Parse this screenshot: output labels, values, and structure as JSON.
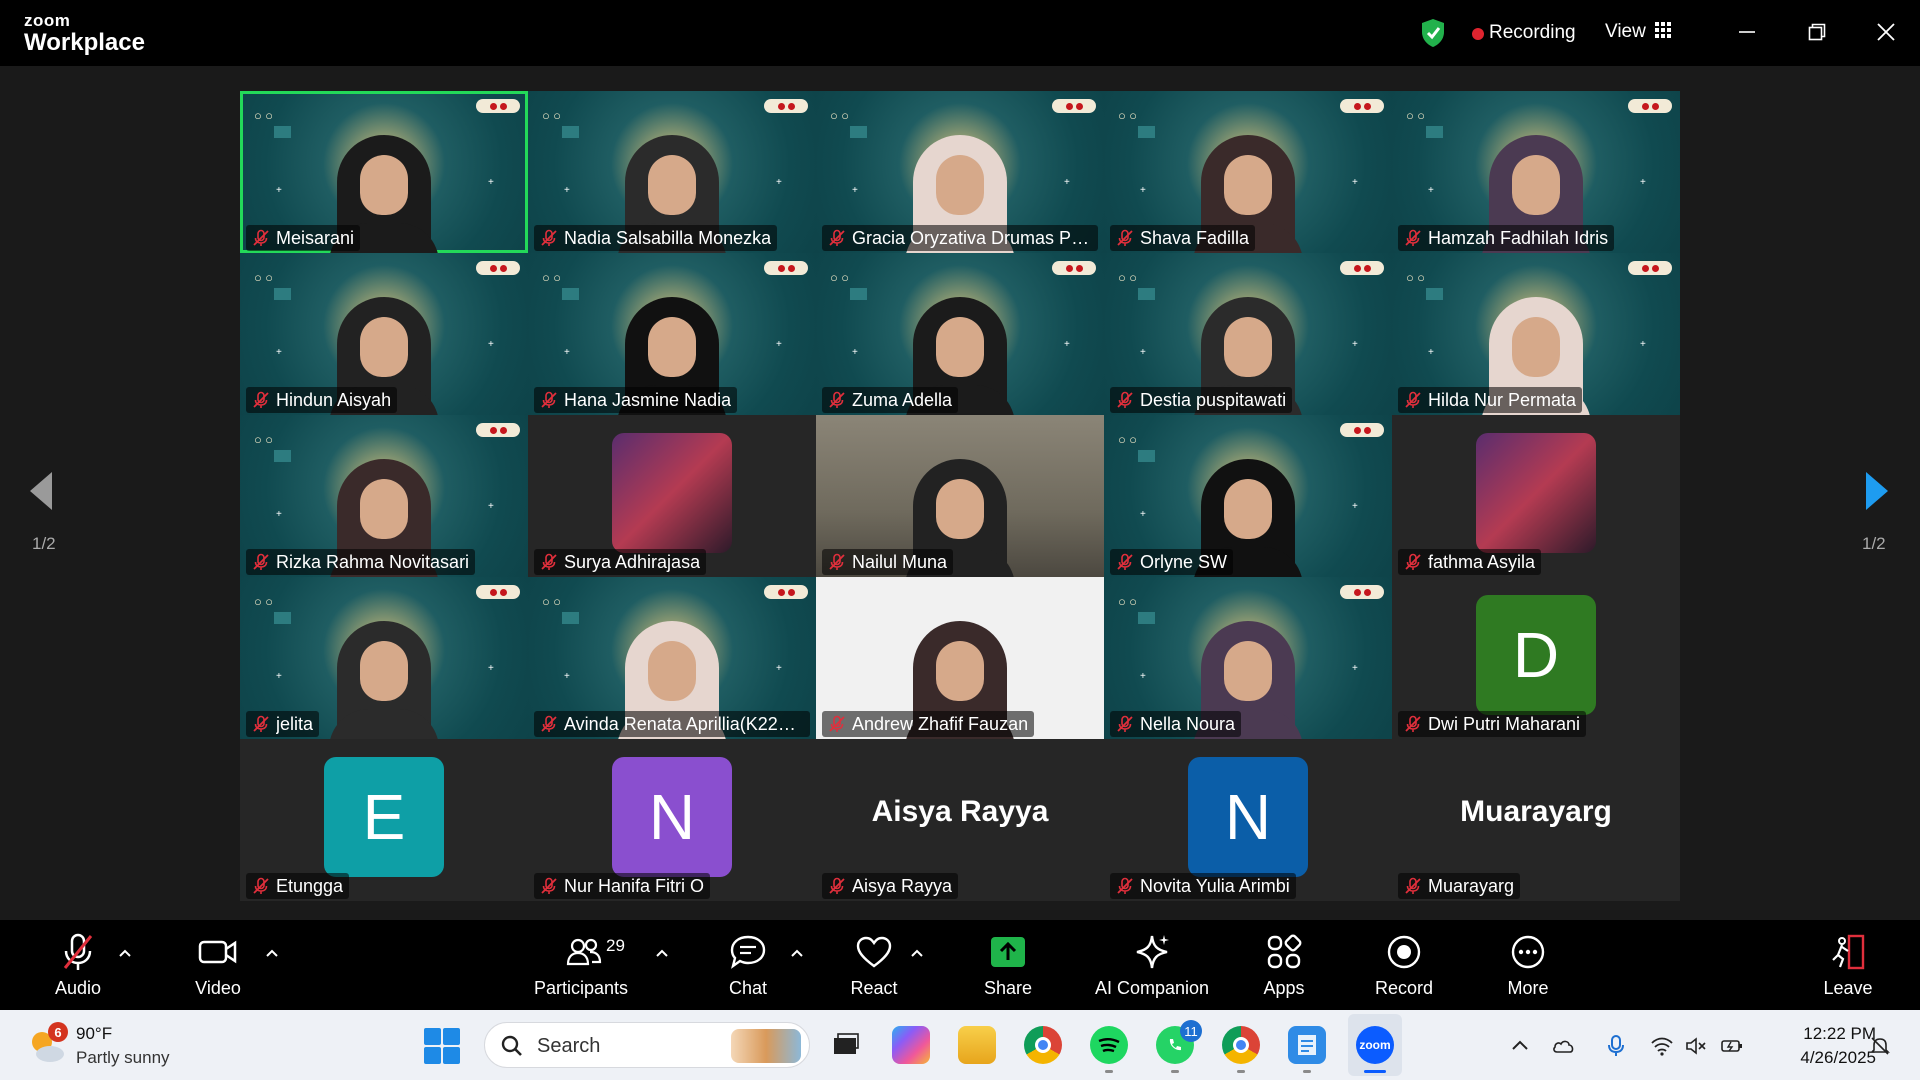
{
  "app": {
    "brand_small": "zoom",
    "brand_large": "Workplace"
  },
  "titlebar": {
    "recording_label": "Recording",
    "view_label": "View"
  },
  "pagination": {
    "left": "1/2",
    "right": "1/2"
  },
  "tiles": [
    {
      "name": "Meisarani",
      "kind": "bg",
      "active": true
    },
    {
      "name": "Nadia Salsabilla Monezka",
      "kind": "bg"
    },
    {
      "name": "Gracia Oryzativa Drumas Pa...",
      "kind": "bg"
    },
    {
      "name": "Shava Fadilla",
      "kind": "bg"
    },
    {
      "name": "Hamzah Fadhilah Idris",
      "kind": "bg"
    },
    {
      "name": "Hindun Aisyah",
      "kind": "bg"
    },
    {
      "name": "Hana Jasmine Nadia",
      "kind": "bg"
    },
    {
      "name": "Zuma Adella",
      "kind": "bg"
    },
    {
      "name": "Destia puspitawati",
      "kind": "bg"
    },
    {
      "name": "Hilda Nur Permata",
      "kind": "bg"
    },
    {
      "name": "Rizka Rahma Novitasari",
      "kind": "bg"
    },
    {
      "name": "Surya Adhirajasa",
      "kind": "plain",
      "picture": true
    },
    {
      "name": "Nailul Muna",
      "kind": "photo"
    },
    {
      "name": "Orlyne SW",
      "kind": "bg"
    },
    {
      "name": "fathma Asyila",
      "kind": "plain",
      "picture": true
    },
    {
      "name": "jelita",
      "kind": "bg"
    },
    {
      "name": "Avinda Renata Aprillia(K2224003)",
      "kind": "bg"
    },
    {
      "name": "Andrew Zhafif Fauzan",
      "kind": "white"
    },
    {
      "name": "Nella Noura",
      "kind": "bg"
    },
    {
      "name": "Dwi Putri Maharani",
      "kind": "plain",
      "avatar_letter": "D",
      "avatar_color": "#2f7a22"
    },
    {
      "name": "Etungga",
      "kind": "plain",
      "avatar_letter": "E",
      "avatar_color": "#0e9fa6"
    },
    {
      "name": "Nur Hanifa Fitri O",
      "kind": "plain",
      "avatar_letter": "N",
      "avatar_color": "#8a4fcf"
    },
    {
      "name": "Aisya Rayya",
      "kind": "plain",
      "display_name": "Aisya Rayya"
    },
    {
      "name": "Novita Yulia Arimbi",
      "kind": "plain",
      "avatar_letter": "N",
      "avatar_color": "#0b5ea8"
    },
    {
      "name": "Muarayarg",
      "kind": "plain",
      "display_name": "Muarayarg"
    }
  ],
  "toolbar": {
    "audio": "Audio",
    "video": "Video",
    "participants": "Participants",
    "participants_count": "29",
    "chat": "Chat",
    "react": "React",
    "share": "Share",
    "ai_companion": "AI Companion",
    "apps": "Apps",
    "record": "Record",
    "more": "More",
    "leave": "Leave"
  },
  "taskbar": {
    "weather_badge": "6",
    "weather_temp": "90°F",
    "weather_desc": "Partly sunny",
    "search_placeholder": "Search",
    "whatsapp_badge": "11",
    "zoom_label": "zoom",
    "time": "12:22 PM",
    "date": "4/26/2025"
  },
  "colors": {
    "active_speaker": "#23d959",
    "recording": "#e0242f",
    "share_green": "#1fb44a",
    "muted_red": "#e02f3c"
  }
}
